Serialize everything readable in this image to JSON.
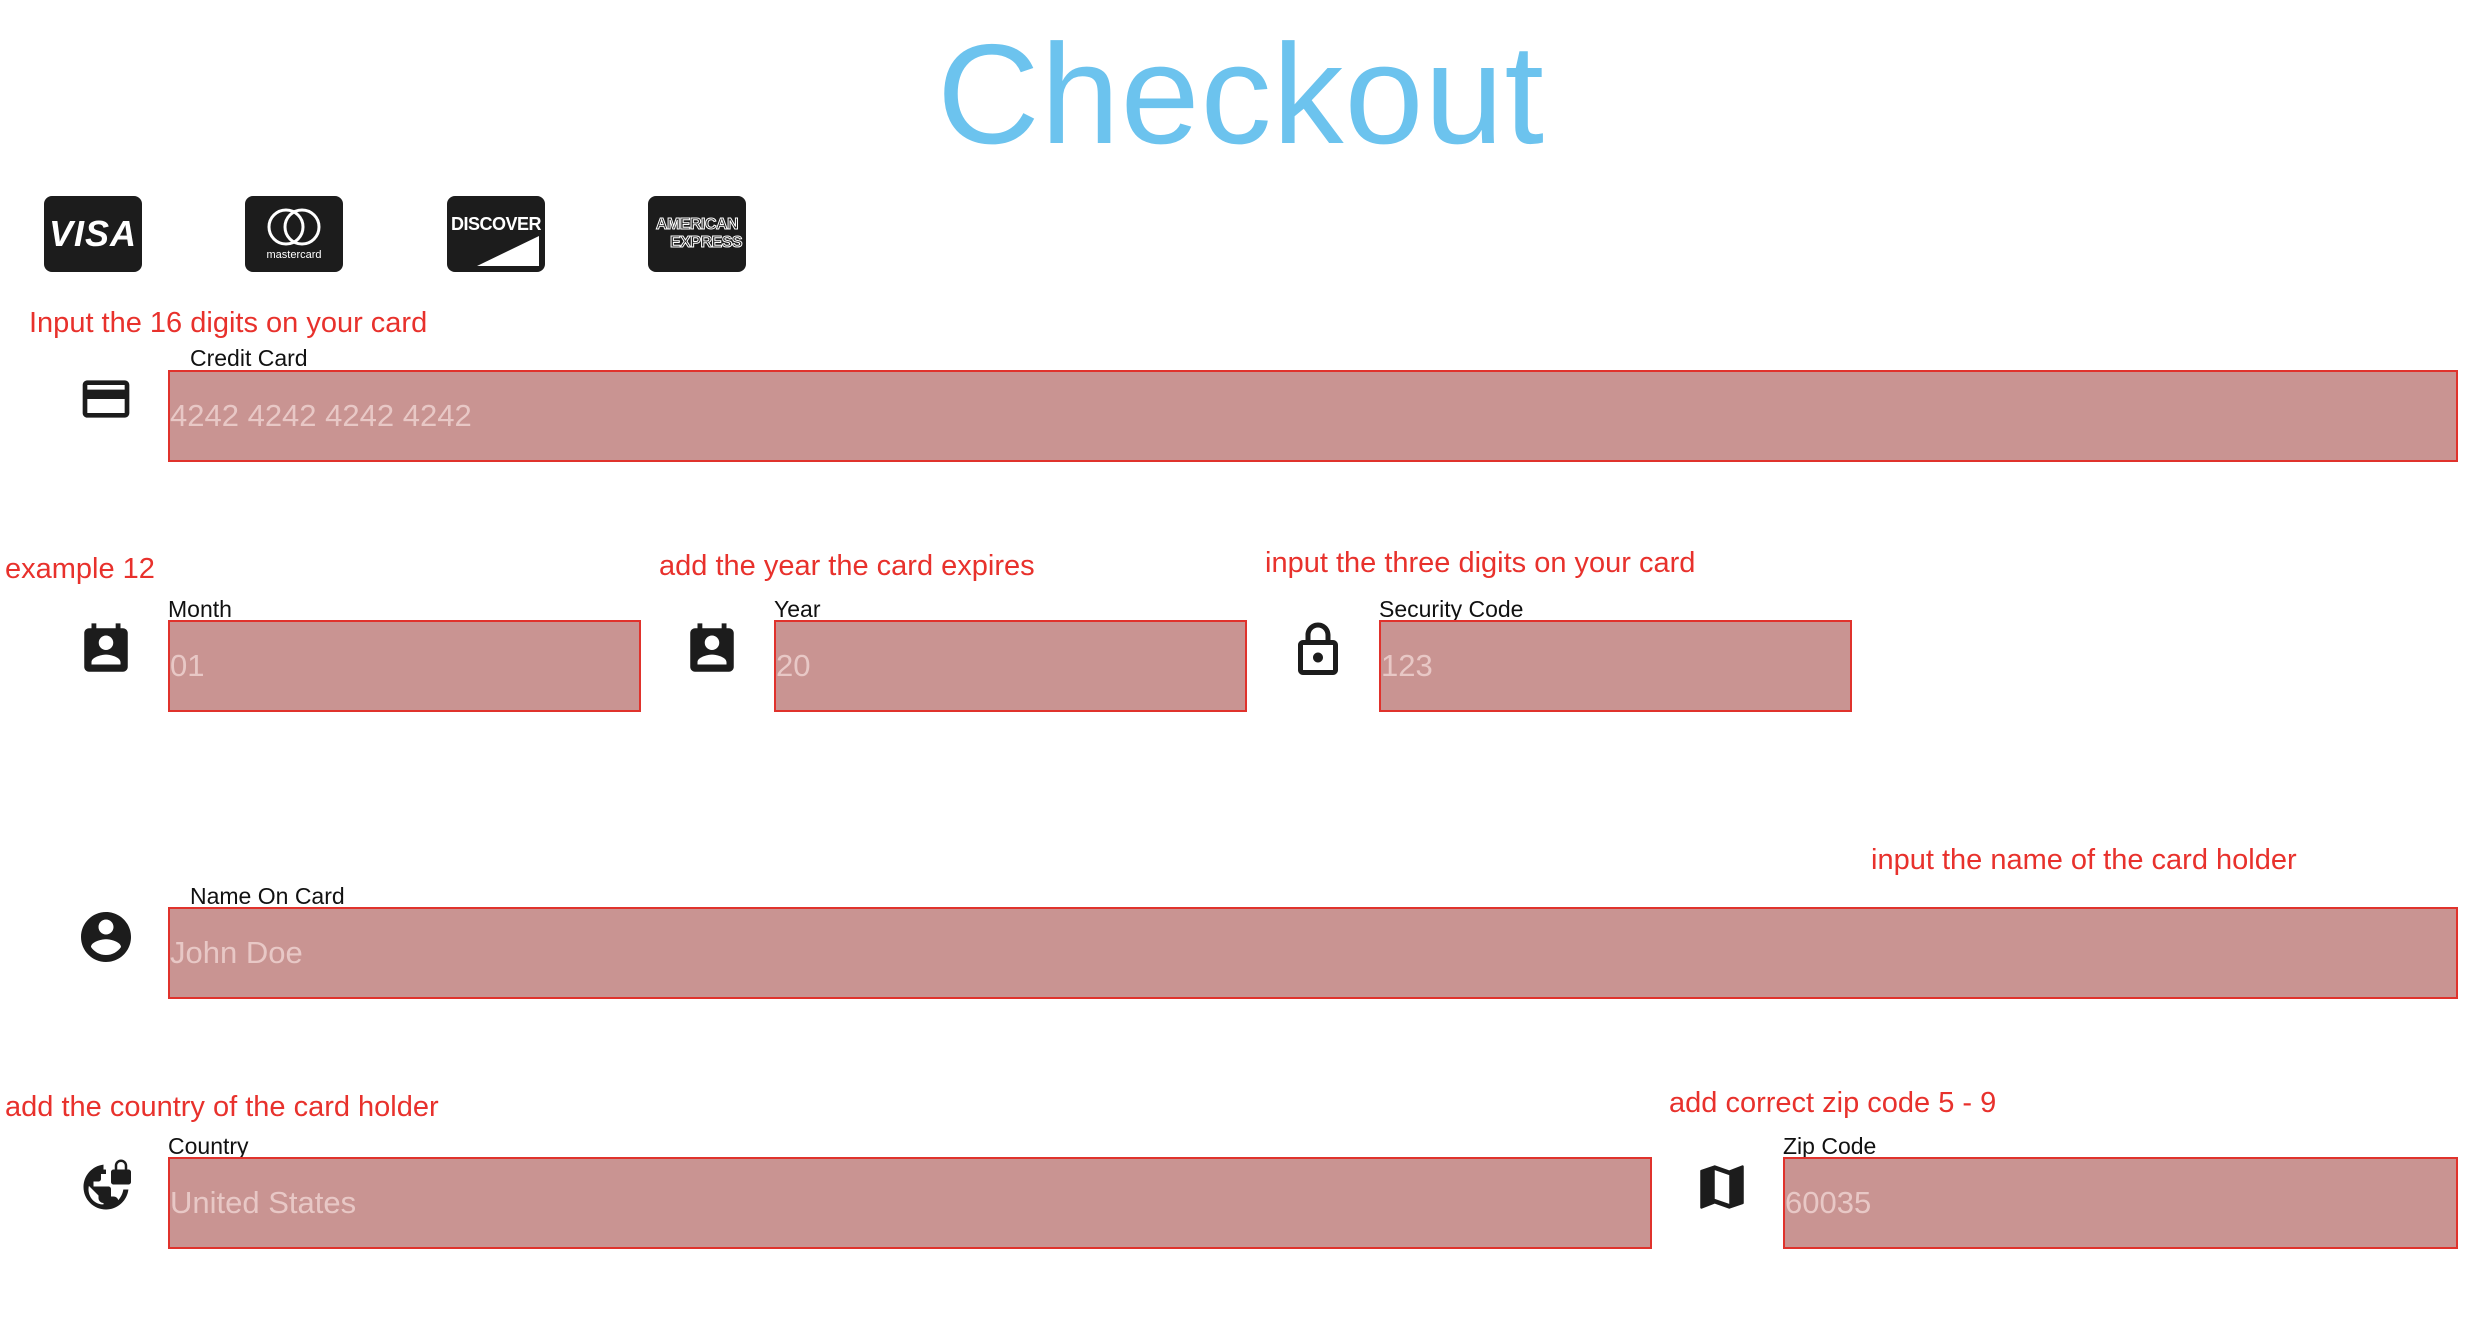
{
  "header": {
    "title": "Checkout"
  },
  "card_logos": [
    {
      "name": "visa",
      "text": "VISA"
    },
    {
      "name": "mastercard",
      "text": "mastercard"
    },
    {
      "name": "discover",
      "text": "DISCOVER"
    },
    {
      "name": "american-express",
      "line1": "AMERICAN",
      "line2": "EXPRESS"
    }
  ],
  "colors": {
    "title": "#6cc3ee",
    "hint": "#e8312c",
    "field_fill": "#c99492",
    "field_border": "#e0322c",
    "icon": "#1c1c1c"
  },
  "form": {
    "credit_card": {
      "hint": "Input the 16 digits on your card",
      "label": "Credit Card",
      "placeholder": "4242 4242 4242 4242",
      "icon": "credit-card-icon"
    },
    "month": {
      "hint": "example 12",
      "label": "Month",
      "placeholder": "01",
      "icon": "contact-calendar-icon"
    },
    "year": {
      "hint": "add the year the card expires",
      "label": "Year",
      "placeholder": "20",
      "icon": "contact-calendar-icon"
    },
    "security_code": {
      "hint": "input the three digits on your card",
      "label": "Security Code",
      "placeholder": "123",
      "icon": "lock-icon"
    },
    "name_on_card": {
      "hint": "input the name of the card holder",
      "label": "Name On Card",
      "placeholder": "John Doe",
      "icon": "account-circle-icon"
    },
    "country": {
      "hint": "add the country of the card holder",
      "label": "Country",
      "placeholder": "United States",
      "icon": "public-lock-icon"
    },
    "zip_code": {
      "hint": "add correct zip code 5 - 9",
      "label": "Zip Code",
      "placeholder": "60035",
      "icon": "map-icon"
    }
  }
}
